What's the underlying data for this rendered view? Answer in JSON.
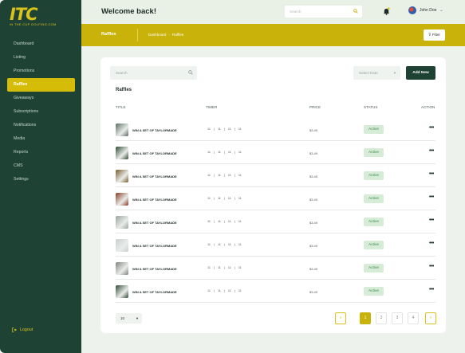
{
  "brand": {
    "logo_text": "ITC",
    "logo_subtext": "IN THE CUP GOLFING.COM"
  },
  "sidebar": {
    "items": [
      {
        "label": "Dashboard",
        "active": false
      },
      {
        "label": "Listing",
        "active": false
      },
      {
        "label": "Promotions",
        "active": false
      },
      {
        "label": "Raffles",
        "active": true
      },
      {
        "label": "Giveaways",
        "active": false
      },
      {
        "label": "Subscriptions",
        "active": false
      },
      {
        "label": "Notifications",
        "active": false
      },
      {
        "label": "Media",
        "active": false
      },
      {
        "label": "Reports",
        "active": false
      },
      {
        "label": "CMS",
        "active": false
      },
      {
        "label": "Settings",
        "active": false
      }
    ],
    "logout_label": "Logout"
  },
  "header": {
    "welcome": "Welcome back!",
    "search_placeholder": "Search",
    "user_name": "John Doe"
  },
  "banner": {
    "title": "Raffles",
    "breadcrumb": [
      "Dashboard",
      "-",
      "Raffles"
    ],
    "filter_label": "Filter"
  },
  "toolbar": {
    "search_placeholder": "Search",
    "select_date_placeholder": "Select Date",
    "add_new_label": "Add New"
  },
  "table": {
    "section_title": "Raffles",
    "columns": [
      "TITLE",
      "TIMER",
      "PRICE",
      "STATUS",
      "ACTION"
    ],
    "rows": [
      {
        "title": "WIN A SET OF TAYLORMADE",
        "timer": [
          "11",
          "11",
          "11",
          "11"
        ],
        "price": "$3.49",
        "status": "Active",
        "thumb": "#5c6a62"
      },
      {
        "title": "WIN A SET OF TAYLORMADE",
        "timer": [
          "11",
          "11",
          "11",
          "11"
        ],
        "price": "$3.49",
        "status": "Active",
        "thumb": "#2f4a33"
      },
      {
        "title": "WIN A SET OF TAYLORMADE",
        "timer": [
          "11",
          "11",
          "11",
          "11"
        ],
        "price": "$3.45",
        "status": "Active",
        "thumb": "#7a5a2a"
      },
      {
        "title": "WIN A SET OF TAYLORMADE",
        "timer": [
          "11",
          "11",
          "11",
          "11"
        ],
        "price": "$3.49",
        "status": "Active",
        "thumb": "#8a3b1f"
      },
      {
        "title": "WIN A SET OF TAYLORMADE",
        "timer": [
          "11",
          "11",
          "11",
          "11"
        ],
        "price": "$3.49",
        "status": "Active",
        "thumb": "#9aa3a0"
      },
      {
        "title": "WIN A SET OF TAYLORMADE",
        "timer": [
          "11",
          "11",
          "11",
          "11"
        ],
        "price": "$3.49",
        "status": "Active",
        "thumb": "#c9ced0"
      },
      {
        "title": "WIN A SET OF TAYLORMADE",
        "timer": [
          "11",
          "11",
          "11",
          "11"
        ],
        "price": "$3.49",
        "status": "Active",
        "thumb": "#7d8580"
      },
      {
        "title": "WIN A SET OF TAYLORMADE",
        "timer": [
          "11",
          "11",
          "11",
          "11"
        ],
        "price": "$3.49",
        "status": "Active",
        "thumb": "#2e4a35"
      }
    ]
  },
  "pagination": {
    "per_page": "10",
    "prev_label": "«",
    "next_label": "»",
    "pages": [
      "1",
      "2",
      "3",
      "4"
    ],
    "current": "1"
  },
  "colors": {
    "sidebar_bg": "#1e4234",
    "accent": "#c9b20a",
    "status_active_bg": "#d7ecd7",
    "status_active_text": "#3d8b49"
  }
}
